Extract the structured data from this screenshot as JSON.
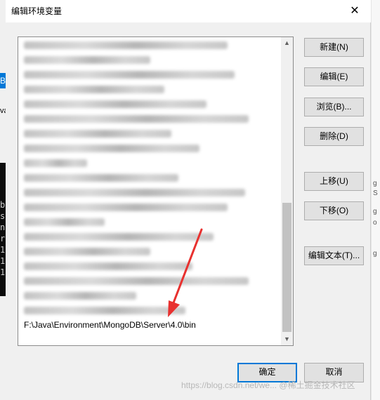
{
  "background": {
    "left_selected_char": "B",
    "left_text": "va",
    "terminal_chars": [
      "b",
      "s",
      "n",
      "r",
      "1",
      "1",
      "1"
    ],
    "right_chars": [
      "g",
      "S",
      "g",
      "o",
      "g"
    ]
  },
  "dialog": {
    "title": "编辑环境变量",
    "close_glyph": "✕",
    "list": {
      "visible_path": "F:\\Java\\Environment\\MongoDB\\Server\\4.0\\bin",
      "blurred_row_count": 19
    },
    "buttons": {
      "new": "新建(N)",
      "edit": "编辑(E)",
      "browse": "浏览(B)...",
      "delete": "删除(D)",
      "move_up": "上移(U)",
      "move_down": "下移(O)",
      "edit_text": "编辑文本(T)...",
      "ok": "确定",
      "cancel": "取消"
    },
    "annotation_arrow_color": "#e8312f"
  },
  "watermark": "https://blog.csdn.net/we... @稀土掘金技术社区",
  "colors": {
    "accent": "#0078d7",
    "dialog_bg": "#f0f0f0",
    "button_bg": "#e1e1e1"
  }
}
